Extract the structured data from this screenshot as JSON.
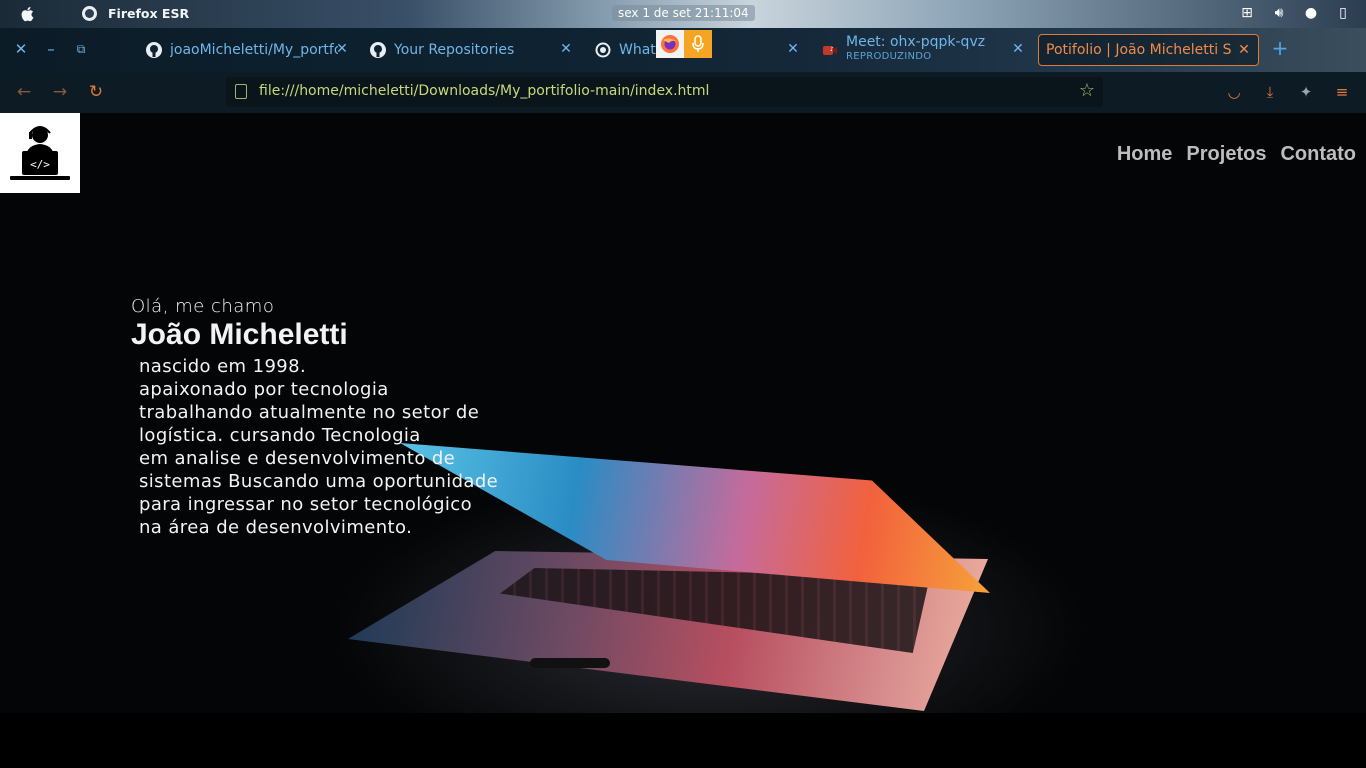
{
  "os": {
    "app_name": "Firefox ESR",
    "clock": "sex 1 de set  21:11:04"
  },
  "tabs": [
    {
      "label": "joaoMicheletti/My_portfo",
      "icon": "github-icon"
    },
    {
      "label": "Your Repositories",
      "icon": "github-icon"
    },
    {
      "label": "WhatsApp",
      "icon": "whatsapp-icon"
    },
    {
      "label": "Meet: ohx-pqpk-qvz",
      "sub": "REPRODUZINDO",
      "icon": "meet-icon"
    },
    {
      "label": "Potifolio | João Micheletti So",
      "icon": "page-icon",
      "active": true
    }
  ],
  "nav": {
    "url": "file:///home/micheletti/Downloads/My_portifolio-main/index.html"
  },
  "site": {
    "menu": [
      "Home",
      "Projetos",
      "Contato"
    ],
    "greeting": "Olá, me chamo",
    "name": "João Micheletti",
    "bio": [
      "nascido em 1998.",
      "apaixonado por tecnologia",
      "trabalhando atualmente no setor de",
      "logística. cursando Tecnologia",
      "em analise e desenvolvimento de",
      "sistemas Buscando uma oportunidade",
      "para ingressar no setor tecnológico",
      "na área de desenvolvimento."
    ]
  },
  "colors": {
    "tab_text": "#6fb6ea",
    "active_tab": "#f08a4b",
    "url_text": "#c9d97a",
    "menu_text": "#bdbdbd"
  }
}
